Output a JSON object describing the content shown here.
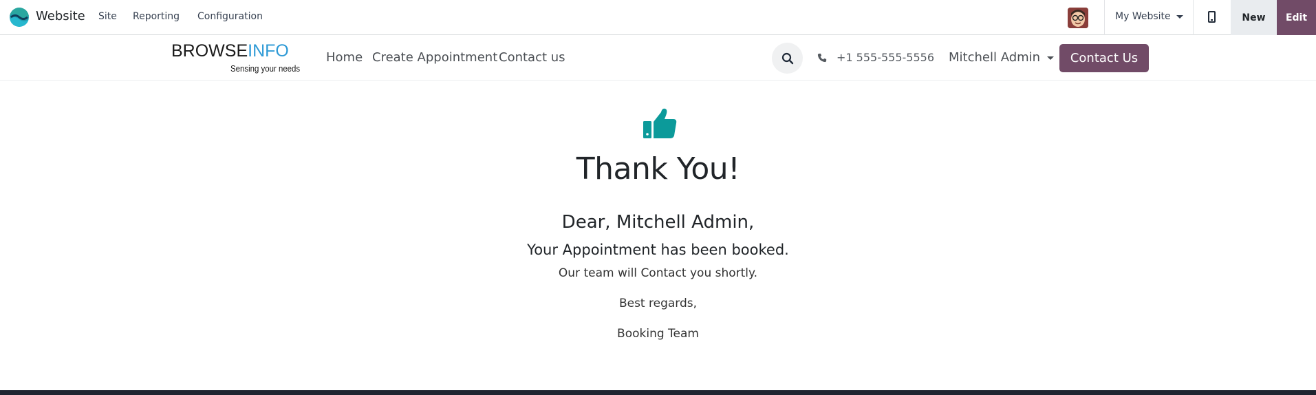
{
  "admin_bar": {
    "app_name": "Website",
    "menus": [
      "Site",
      "Reporting",
      "Configuration"
    ],
    "website_selector": "My Website",
    "new_label": "New",
    "edit_label": "Edit"
  },
  "site_header": {
    "brand_part1": "BROWSE",
    "brand_part2": "INFO",
    "brand_tagline": "Sensing your needs",
    "nav": [
      "Home",
      "Create Appointment",
      "Contact us"
    ],
    "phone": "+1 555-555-5556",
    "user_name": "Mitchell Admin",
    "contact_button": "Contact Us"
  },
  "content": {
    "heading": "Thank You!",
    "greeting": "Dear, Mitchell Admin,",
    "message": "Your Appointment has been booked.",
    "followup": "Our team will Contact you shortly.",
    "closing": "Best regards,",
    "signature": "Booking Team"
  },
  "colors": {
    "primary": "#714b67",
    "accent": "#0c9a9a",
    "brand_blue": "#2e9ad6"
  }
}
